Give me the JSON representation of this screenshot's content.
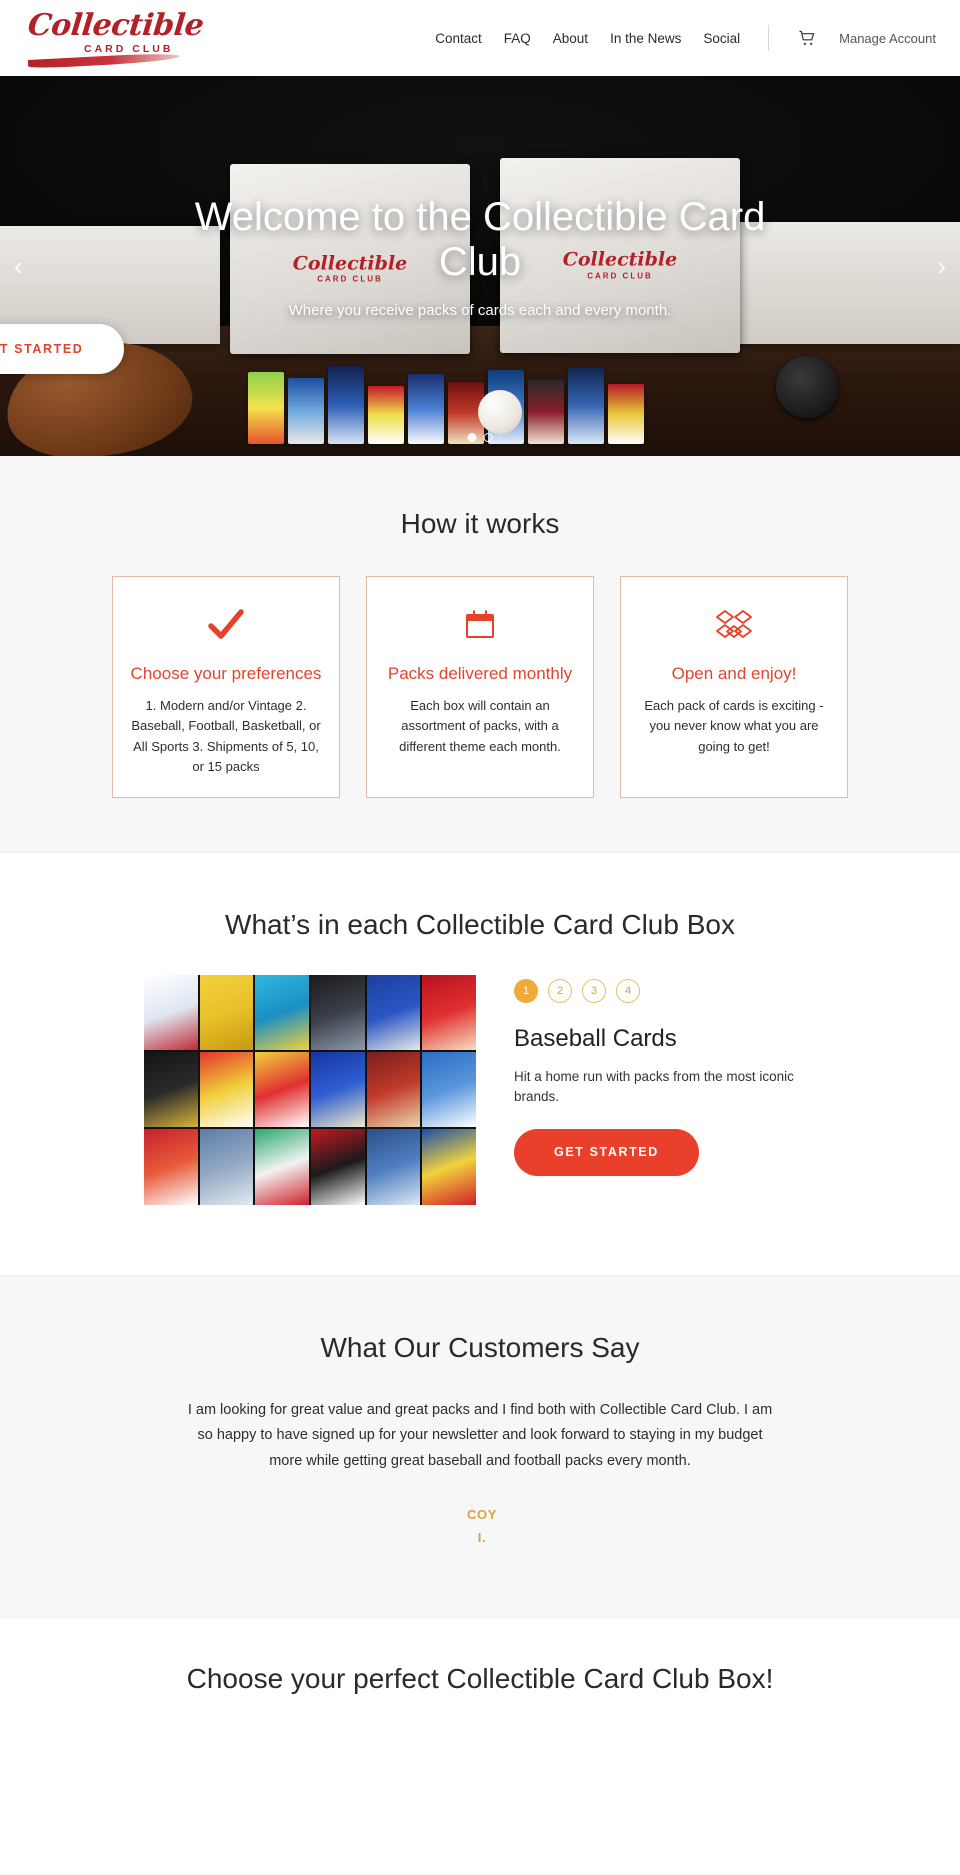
{
  "header": {
    "logo": {
      "script": "Collectible",
      "sub": "CARD CLUB"
    },
    "nav": [
      {
        "label": "Contact"
      },
      {
        "label": "FAQ"
      },
      {
        "label": "About"
      },
      {
        "label": "In the News"
      },
      {
        "label": "Social"
      }
    ],
    "cart_icon": "shopping-cart-icon",
    "account_label": "Manage Account"
  },
  "hero": {
    "title": "Welcome to the Collectible Card Club",
    "subtitle": "Where you receive packs of cards each and every month.",
    "cta_label": "GET STARTED",
    "prev_icon": "chevron-left-icon",
    "next_icon": "chevron-right-icon",
    "slides": 2,
    "active_slide": 1,
    "box_label": {
      "script": "Collectible",
      "sub": "CARD CLUB"
    }
  },
  "how_it_works": {
    "title": "How it works",
    "cards": [
      {
        "icon": "checkmark-icon",
        "title": "Choose your preferences",
        "body": "1. Modern and/or Vintage 2. Baseball, Football, Basketball, or All Sports 3. Shipments of 5, 10, or 15 packs"
      },
      {
        "icon": "calendar-icon",
        "title": "Packs delivered monthly",
        "body": "Each box will contain an assortment of packs, with a different theme each month."
      },
      {
        "icon": "open-box-diamonds-icon",
        "title": "Open and enjoy!",
        "body": "Each pack of cards is exciting - you never know what you are going to get!"
      }
    ]
  },
  "whats_in_box": {
    "title": "What’s in each Collectible Card Club Box",
    "image_alt": "baseball-card-packs-photo",
    "steps": [
      "1",
      "2",
      "3",
      "4"
    ],
    "active_step": "1",
    "heading": "Baseball Cards",
    "description": "Hit a home run with packs from the most iconic brands.",
    "cta_label": "GET STARTED"
  },
  "testimonials": {
    "title": "What Our Customers Say",
    "quote": "I am looking for great value and great packs and I find both with Collectible Card Club. I am so happy to have signed up for your newsletter and look forward to staying in my budget more while getting great baseball and football packs every month.",
    "author_line1": "COY",
    "author_line2": "I."
  },
  "bottom": {
    "title": "Choose your perfect Collectible Card Club Box!"
  },
  "colors": {
    "brand_red": "#B32128",
    "accent_red": "#E8402A",
    "accent_amber": "#F2A93B",
    "author_gold": "#D9A23C"
  }
}
